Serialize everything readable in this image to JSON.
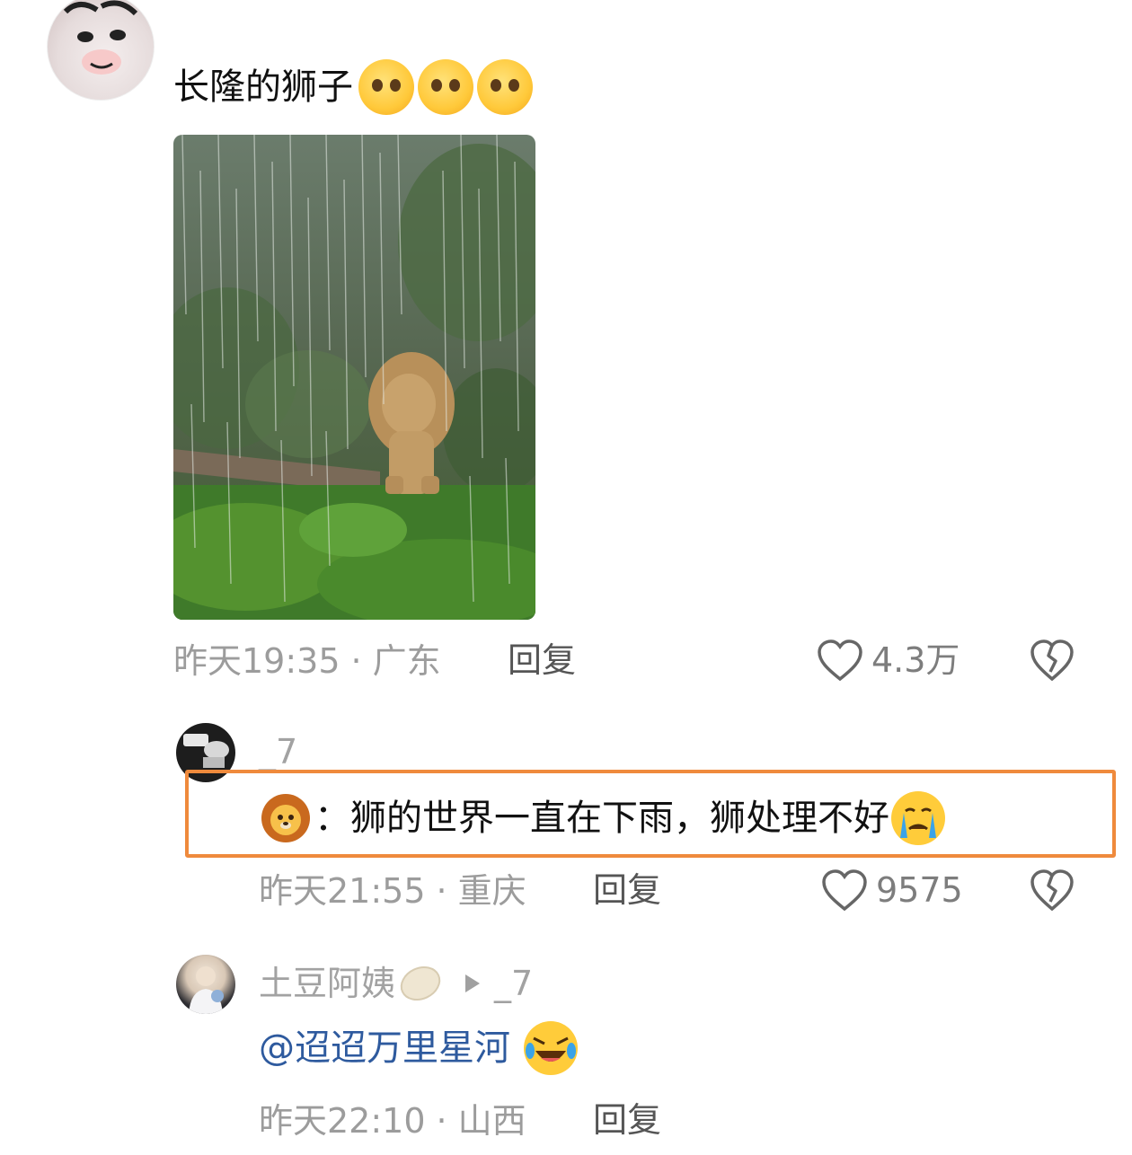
{
  "comment": {
    "text": "长隆的狮子",
    "emoji_icon": "pleading-face-icon",
    "emoji_count": 3,
    "time": "昨天19:35",
    "separator": "·",
    "location": "广东",
    "reply_label": "回复",
    "likes": "4.3万"
  },
  "reply1": {
    "username": "_7",
    "prefix_icon": "lion-face-icon",
    "prefix_colon": "：",
    "text": "狮的世界一直在下雨，狮处理不好",
    "suffix_icon": "crying-face-icon",
    "time": "昨天21:55",
    "separator": "·",
    "location": "重庆",
    "reply_label": "回复",
    "likes": "9575"
  },
  "reply2": {
    "username": "土豆阿姨",
    "username_icon": "potato-icon",
    "reply_to": "_7",
    "mention": "@迢迢万里星河",
    "suffix_icon": "laughing-face-icon",
    "time": "昨天22:10",
    "separator": "·",
    "location": "山西",
    "reply_label": "回复"
  },
  "colors": {
    "highlight_border": "#ef8a3c",
    "mention": "#2e5a9e",
    "meta_text": "#9c9c9c"
  }
}
